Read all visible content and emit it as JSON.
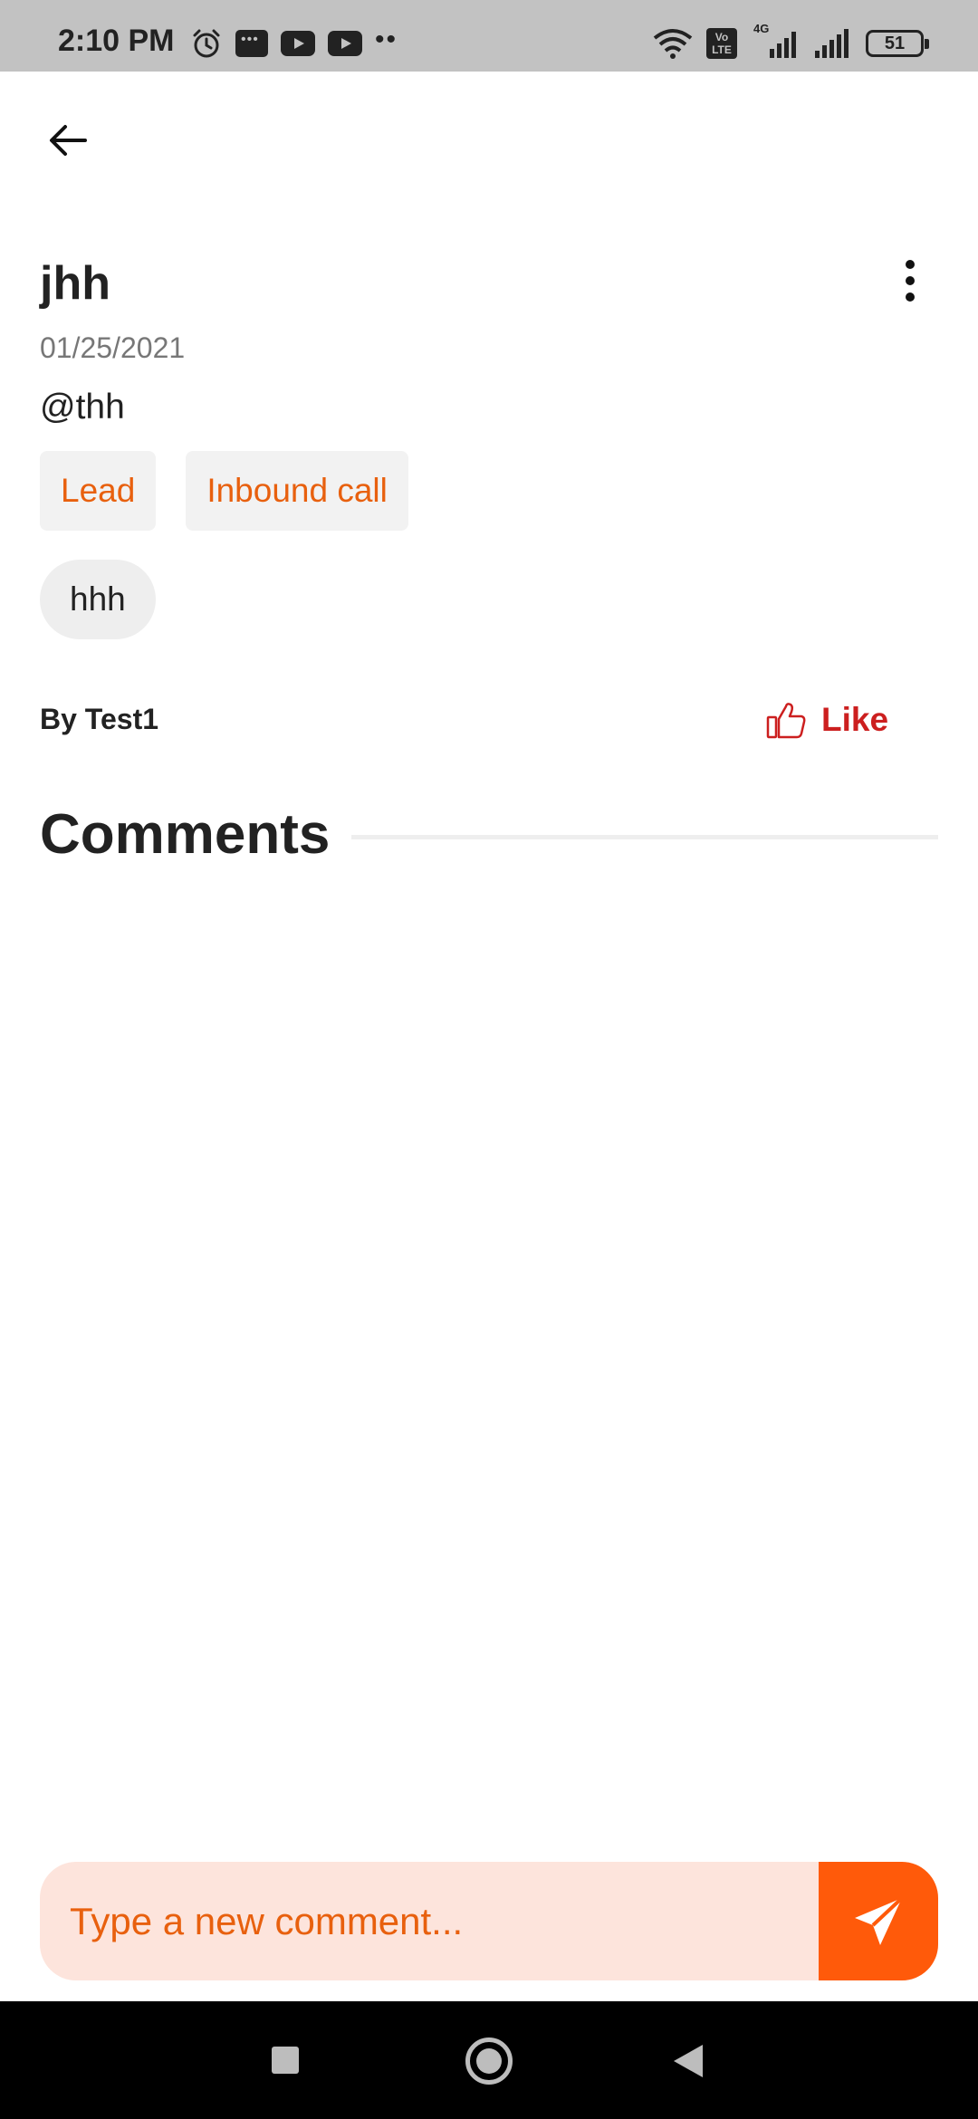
{
  "status_bar": {
    "time": "2:10 PM",
    "battery": "51",
    "network_label": "4G",
    "volte_label": "Vo LTE",
    "icons": [
      "alarm-icon",
      "message-icon",
      "youtube-icon",
      "youtube-icon",
      "more-notifications-icon",
      "wifi-icon",
      "volte-icon",
      "signal-icon",
      "signal-icon",
      "battery-icon"
    ]
  },
  "header": {
    "back_icon": "arrow-left-icon",
    "more_icon": "more-vertical-icon"
  },
  "post": {
    "title": "jhh",
    "date": "01/25/2021",
    "handle": "@thh",
    "tags": [
      "Lead",
      "Inbound call"
    ],
    "pill": "hhh",
    "author": "By Test1",
    "like_label": "Like"
  },
  "comments": {
    "title": "Comments"
  },
  "composer": {
    "placeholder": "Type a new comment...",
    "send_icon": "send-icon"
  },
  "colors": {
    "accent": "#ff5a0a",
    "tag_text": "#e8600e",
    "like": "#cc1f1f",
    "composer_bg": "#fde4dc"
  }
}
